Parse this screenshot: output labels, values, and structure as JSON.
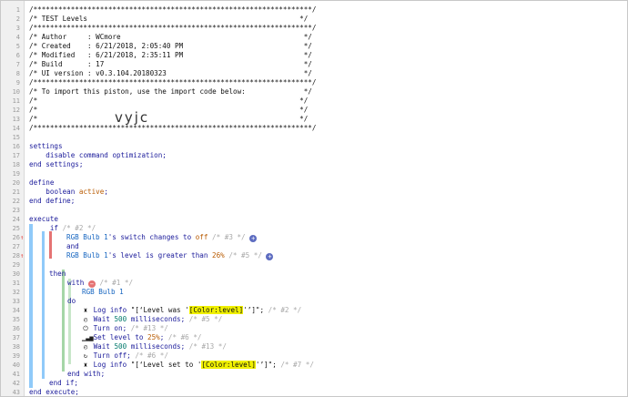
{
  "lines": [
    {
      "n": "1",
      "text": "/*******************************************************************/"
    },
    {
      "n": "2",
      "text": "/* TEST Levels                                                   */"
    },
    {
      "n": "3",
      "text": "/*******************************************************************/"
    },
    {
      "n": "4",
      "text": "/* Author     : WCmore                                            */"
    },
    {
      "n": "5",
      "text": "/* Created    : 6/21/2018, 2:05:40 PM                             */"
    },
    {
      "n": "6",
      "text": "/* Modified   : 6/21/2018, 2:35:11 PM                             */"
    },
    {
      "n": "7",
      "text": "/* Build      : 17                                                */"
    },
    {
      "n": "8",
      "text": "/* UI version : v0.3.104.20180323                                 */"
    },
    {
      "n": "9",
      "text": "/*******************************************************************/"
    },
    {
      "n": "10",
      "text": "/* To import this piston, use the import code below:              */"
    },
    {
      "n": "11",
      "text": "/*                                                               */"
    },
    {
      "n": "12",
      "text": "/*                                                               */"
    },
    {
      "n": "13",
      "text": "/*                                                               */"
    },
    {
      "n": "14",
      "text": "/*******************************************************************/"
    },
    {
      "n": "15",
      "text": ""
    },
    {
      "n": "16",
      "text": "settings"
    },
    {
      "n": "17",
      "text": "    disable command optimization;"
    },
    {
      "n": "18",
      "text": "end settings;"
    },
    {
      "n": "19",
      "text": ""
    },
    {
      "n": "20",
      "text": "define"
    },
    {
      "n": "21",
      "text": "    boolean active;"
    },
    {
      "n": "22",
      "text": "end define;"
    },
    {
      "n": "23",
      "text": ""
    },
    {
      "n": "24",
      "text": "execute"
    },
    {
      "n": "25",
      "text": "    if"
    },
    {
      "n": "26",
      "text": "RGB Bulb 1's switch changes to off"
    },
    {
      "n": "27",
      "text": "and"
    },
    {
      "n": "28",
      "text": "RGB Bulb 1's level is greater than 26%"
    },
    {
      "n": "29",
      "text": ""
    },
    {
      "n": "30",
      "text": "then"
    },
    {
      "n": "31",
      "text": "with"
    },
    {
      "n": "32",
      "text": "RGB Bulb 1"
    },
    {
      "n": "33",
      "text": "do"
    },
    {
      "n": "34",
      "text": "Log info"
    },
    {
      "n": "35",
      "text": "Wait 500 milliseconds;"
    },
    {
      "n": "36",
      "text": "Turn on;"
    },
    {
      "n": "37",
      "text": "Set level to 25%;"
    },
    {
      "n": "38",
      "text": "Wait 500 milliseconds;"
    },
    {
      "n": "39",
      "text": "Turn off;"
    },
    {
      "n": "40",
      "text": "Log info"
    },
    {
      "n": "41",
      "text": "end with;"
    },
    {
      "n": "42",
      "text": "end if;"
    },
    {
      "n": "43",
      "text": "end execute;"
    }
  ],
  "overlay_text": "vyjc",
  "tokens": {
    "settings": "settings",
    "disable": "disable command optimization;",
    "end_settings": "end settings;",
    "define": "define",
    "boolean": "boolean",
    "active": "active",
    "semicolon": ";",
    "end_define": "end define;",
    "execute": "execute",
    "if": "if",
    "if_cmt": "/* #2 */",
    "device": "RGB Bulb 1",
    "cond1_mid": "'s switch changes to ",
    "cond1_val": "off",
    "cond1_cmt": "/* #3 */",
    "and": "and",
    "cond2_mid": "'s level is greater than ",
    "cond2_val": "26%",
    "cond2_cmt": "/* #5 */",
    "then": "then",
    "with": "with",
    "with_cmt": "/* #1 */",
    "do": "do",
    "log_info": "Log info",
    "log1_pre": "\"[‘Level was '",
    "log1_hl": "[Color:level]",
    "log1_post": "'’]\";",
    "log1_cmt": "/* #2 */",
    "wait_pre": "Wait ",
    "wait_num": "500",
    "wait_post": " milliseconds;",
    "wait1_cmt": "/* #5 */",
    "turn_on": "Turn on;",
    "turn_on_cmt": "/* #13 */",
    "set_level_pre": "Set level to ",
    "set_level_val": "25%",
    "set_level_post": ";",
    "set_level_cmt": "/* #6 */",
    "wait2_cmt": "/* #13 */",
    "turn_off": "Turn off;",
    "turn_off_cmt": "/* #6 */",
    "log2_pre": "\"[‘Level set to '",
    "log2_hl": "[Color:level]",
    "log2_post": "'’]\";",
    "log2_cmt": "/* #7 */",
    "end_with": "end with;",
    "end_if": "end if;",
    "end_execute": "end execute;"
  },
  "colors": {
    "keyword": "#1a1a9a",
    "device": "#1565c0",
    "value": "#b85a00",
    "comment": "#a8a8a8",
    "highlight": "#f0f000",
    "bar_execute": "#90caf9",
    "bar_if": "#e57373",
    "bar_then": "#81c784"
  },
  "icons": {
    "plus": "plus-circle-icon",
    "minus": "minus-circle-icon",
    "log": "log-icon",
    "clock": "clock-icon",
    "power": "power-icon",
    "level": "signal-icon",
    "refresh": "refresh-icon",
    "arrow": "up-arrow-icon"
  }
}
